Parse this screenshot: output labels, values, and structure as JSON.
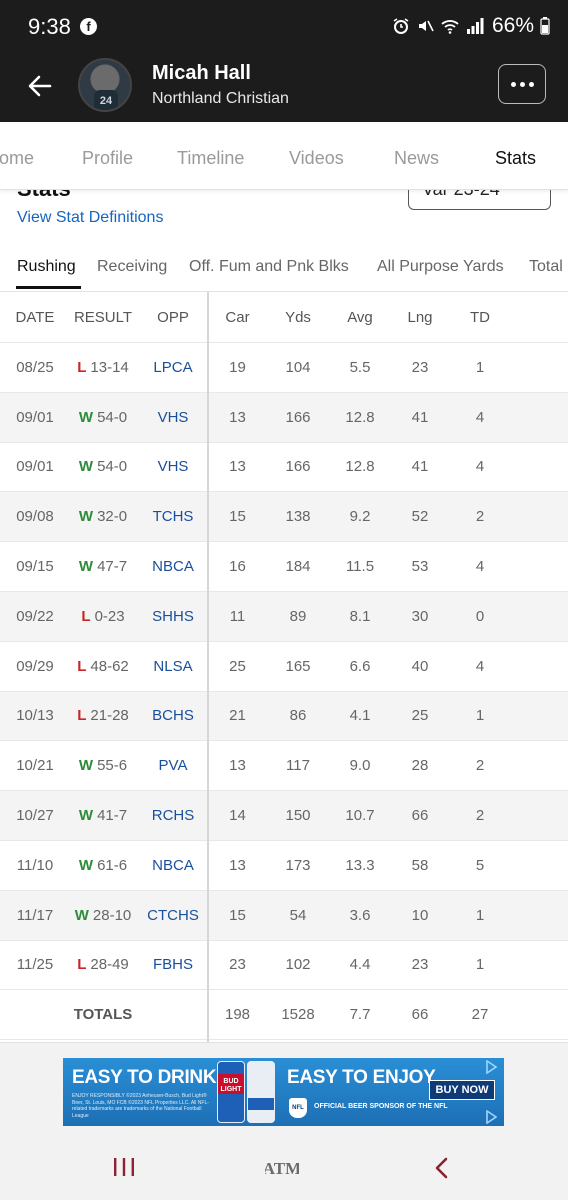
{
  "status_bar": {
    "time": "9:38",
    "battery": "66%"
  },
  "header": {
    "name": "Micah Hall",
    "school": "Northland Christian",
    "jersey_number": "24"
  },
  "tabs": [
    {
      "label": "ome",
      "active": false
    },
    {
      "label": "Profile",
      "active": false
    },
    {
      "label": "Timeline",
      "active": false
    },
    {
      "label": "Videos",
      "active": false
    },
    {
      "label": "News",
      "active": false
    },
    {
      "label": "Stats",
      "active": true
    }
  ],
  "section": {
    "title": "Stats",
    "season": "Var 23-24",
    "definitions_link": "View Stat Definitions"
  },
  "subtabs": [
    {
      "label": "Rushing",
      "active": true
    },
    {
      "label": "Receiving",
      "active": false
    },
    {
      "label": "Off. Fum and Pnk Blks",
      "active": false
    },
    {
      "label": "All Purpose Yards",
      "active": false
    },
    {
      "label": "Total",
      "active": false
    }
  ],
  "table": {
    "columns": [
      "DATE",
      "RESULT",
      "OPP",
      "Car",
      "Yds",
      "Avg",
      "Lng",
      "TD"
    ],
    "rows": [
      {
        "date": "08/25",
        "wl": "L",
        "score": "13-14",
        "opp": "LPCA",
        "car": "19",
        "yds": "104",
        "avg": "5.5",
        "lng": "23",
        "td": "1"
      },
      {
        "date": "09/01",
        "wl": "W",
        "score": "54-0",
        "opp": "VHS",
        "car": "13",
        "yds": "166",
        "avg": "12.8",
        "lng": "41",
        "td": "4"
      },
      {
        "date": "09/01",
        "wl": "W",
        "score": "54-0",
        "opp": "VHS",
        "car": "13",
        "yds": "166",
        "avg": "12.8",
        "lng": "41",
        "td": "4"
      },
      {
        "date": "09/08",
        "wl": "W",
        "score": "32-0",
        "opp": "TCHS",
        "car": "15",
        "yds": "138",
        "avg": "9.2",
        "lng": "52",
        "td": "2"
      },
      {
        "date": "09/15",
        "wl": "W",
        "score": "47-7",
        "opp": "NBCA",
        "car": "16",
        "yds": "184",
        "avg": "11.5",
        "lng": "53",
        "td": "4"
      },
      {
        "date": "09/22",
        "wl": "L",
        "score": "0-23",
        "opp": "SHHS",
        "car": "11",
        "yds": "89",
        "avg": "8.1",
        "lng": "30",
        "td": "0"
      },
      {
        "date": "09/29",
        "wl": "L",
        "score": "48-62",
        "opp": "NLSA",
        "car": "25",
        "yds": "165",
        "avg": "6.6",
        "lng": "40",
        "td": "4"
      },
      {
        "date": "10/13",
        "wl": "L",
        "score": "21-28",
        "opp": "BCHS",
        "car": "21",
        "yds": "86",
        "avg": "4.1",
        "lng": "25",
        "td": "1"
      },
      {
        "date": "10/21",
        "wl": "W",
        "score": "55-6",
        "opp": "PVA",
        "car": "13",
        "yds": "117",
        "avg": "9.0",
        "lng": "28",
        "td": "2"
      },
      {
        "date": "10/27",
        "wl": "W",
        "score": "41-7",
        "opp": "RCHS",
        "car": "14",
        "yds": "150",
        "avg": "10.7",
        "lng": "66",
        "td": "2"
      },
      {
        "date": "11/10",
        "wl": "W",
        "score": "61-6",
        "opp": "NBCA",
        "car": "13",
        "yds": "173",
        "avg": "13.3",
        "lng": "58",
        "td": "5"
      },
      {
        "date": "11/17",
        "wl": "W",
        "score": "28-10",
        "opp": "CTCHS",
        "car": "15",
        "yds": "54",
        "avg": "3.6",
        "lng": "10",
        "td": "1"
      },
      {
        "date": "11/25",
        "wl": "L",
        "score": "28-49",
        "opp": "FBHS",
        "car": "23",
        "yds": "102",
        "avg": "4.4",
        "lng": "23",
        "td": "1"
      }
    ],
    "totals": {
      "label": "TOTALS",
      "car": "198",
      "yds": "1528",
      "avg": "7.7",
      "lng": "66",
      "td": "27"
    }
  },
  "ad": {
    "headline_left": "EASY TO DRINK.",
    "headline_right": "EASY TO ENJOY.",
    "cta": "BUY NOW",
    "fine_print": "ENJOY RESPONSIBLY ©2023 Anheuser-Busch, Bud Light® Beer, St. Louis, MO FCB ©2023 NFL Properties LLC. All NFL-related trademarks are trademarks of the National Football League",
    "sponsor_text": "OFFICIAL BEER SPONSOR OF THE NFL",
    "can_label": "BUD LIGHT",
    "nfl_badge": "NFL",
    "brand_colors": {
      "primary": "#1d6fb4",
      "dark": "#0e3a78"
    }
  },
  "nav": {
    "home_logo": "ATM"
  },
  "colors": {
    "header_bg": "#1c1c1c",
    "win": "#2e8b3a",
    "loss": "#c62828",
    "link": "#1565c0",
    "opponent": "#1a4f9c"
  }
}
